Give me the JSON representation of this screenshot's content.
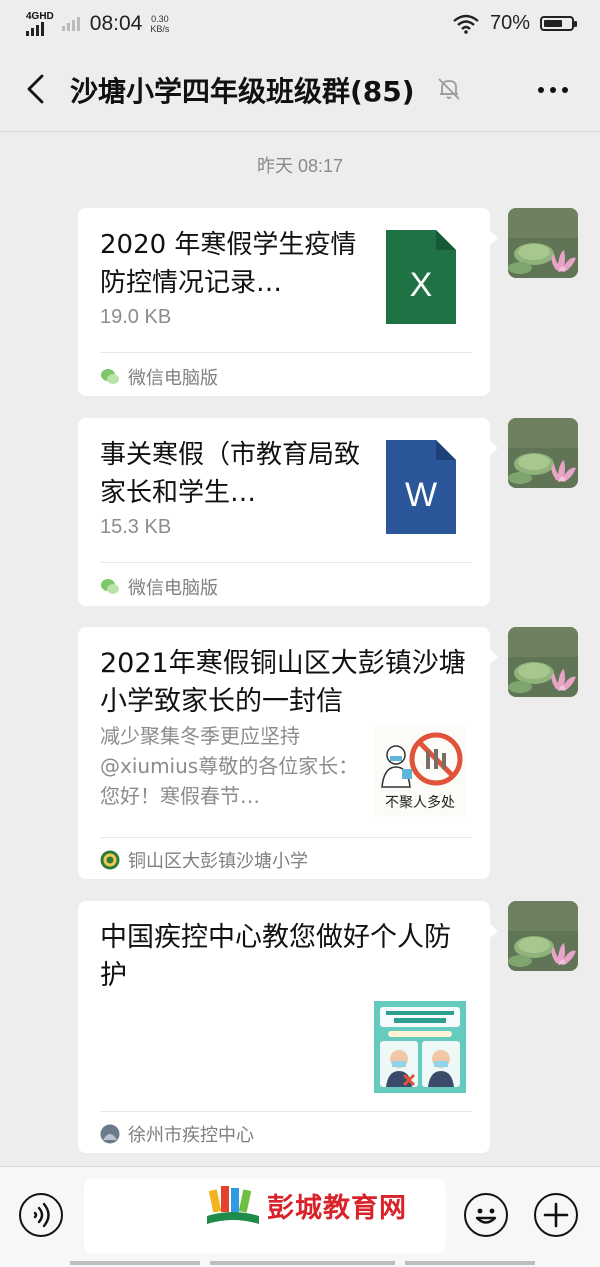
{
  "status_bar": {
    "network": "4GHD",
    "time": "08:04",
    "speed_value": "0.30",
    "speed_unit": "KB/s",
    "battery": "70%",
    "battery_level": 0.7,
    "icons": [
      "signal-icon",
      "wifi-icon",
      "battery-icon"
    ]
  },
  "header": {
    "title": "沙塘小学四年级班级群(85)",
    "icons": [
      "back-icon",
      "mute-bell-icon",
      "more-icon"
    ]
  },
  "chat": {
    "timestamp": "昨天 08:17",
    "messages": [
      {
        "type": "file",
        "title": "2020 年寒假学生疫情防控情况记录…",
        "size": "19.0 KB",
        "file_icon": "excel-icon",
        "file_letter": "X",
        "file_color": "#1f7244",
        "source": "微信电脑版"
      },
      {
        "type": "file",
        "title": "事关寒假（市教育局致家长和学生…",
        "size": "15.3 KB",
        "file_icon": "word-icon",
        "file_letter": "W",
        "file_color": "#2b579a",
        "source": "微信电脑版"
      },
      {
        "type": "link",
        "title": "2021年寒假铜山区大彭镇沙塘小学致家长的一封信",
        "desc": "减少聚集冬季更应坚持@xiumius尊敬的各位家长：您好！寒假春节…",
        "thumb_text": "不聚人多处",
        "source": "铜山区大彭镇沙塘小学"
      },
      {
        "type": "link",
        "title": "中国疾控中心教您做好个人防护",
        "source": "徐州市疾控中心"
      }
    ]
  },
  "footer": {
    "watermark": "彭城教育网",
    "icons": [
      "voice-icon",
      "emoji-icon",
      "plus-icon"
    ]
  },
  "colors": {
    "background": "#ededed",
    "card": "#ffffff",
    "watermark": "#d8232a"
  }
}
